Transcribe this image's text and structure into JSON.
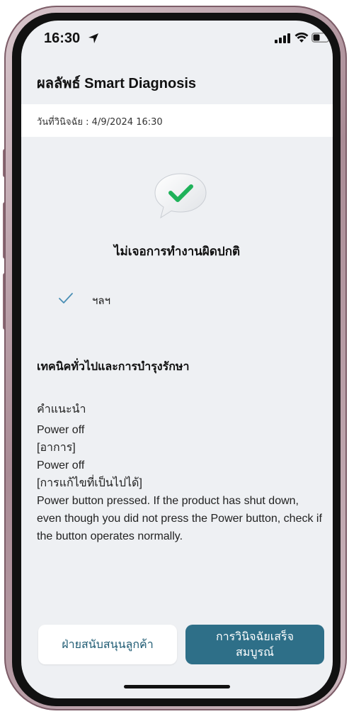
{
  "status_bar": {
    "time": "16:30",
    "icons": [
      "location-arrow-icon",
      "signal-icon",
      "wifi-icon",
      "battery-icon"
    ]
  },
  "header": {
    "title": "ผลลัพธ์ Smart Diagnosis"
  },
  "diagnosis": {
    "date_label": "วันที่วินิจฉัย : 4/9/2024 16:30",
    "status_icon": "check-bubble-icon",
    "result": "ไม่เจอการทำงานผิดปกติ",
    "items": [
      {
        "icon": "check-icon",
        "label": "ฯลฯ"
      }
    ]
  },
  "tips": {
    "heading": "เทคนิคทั่วไปและการบำรุงรักษา",
    "advice_title": "คำแนะนำ",
    "lines": [
      "Power off",
      "[อาการ]",
      "Power off",
      "[การแก้ไขที่เป็นไปได้]",
      "Power button pressed. If the product has shut down, even though you did not press the Power button, check if the button operates normally."
    ]
  },
  "actions": {
    "support_label": "ฝ่ายสนับสนุนลูกค้า",
    "complete_label": "การวินิจฉัยเสร็จสมบูรณ์"
  },
  "colors": {
    "accent": "#2e6f88",
    "check_green": "#1fb25a",
    "screen_bg": "#eef0f3",
    "frame": "#a98b95"
  }
}
